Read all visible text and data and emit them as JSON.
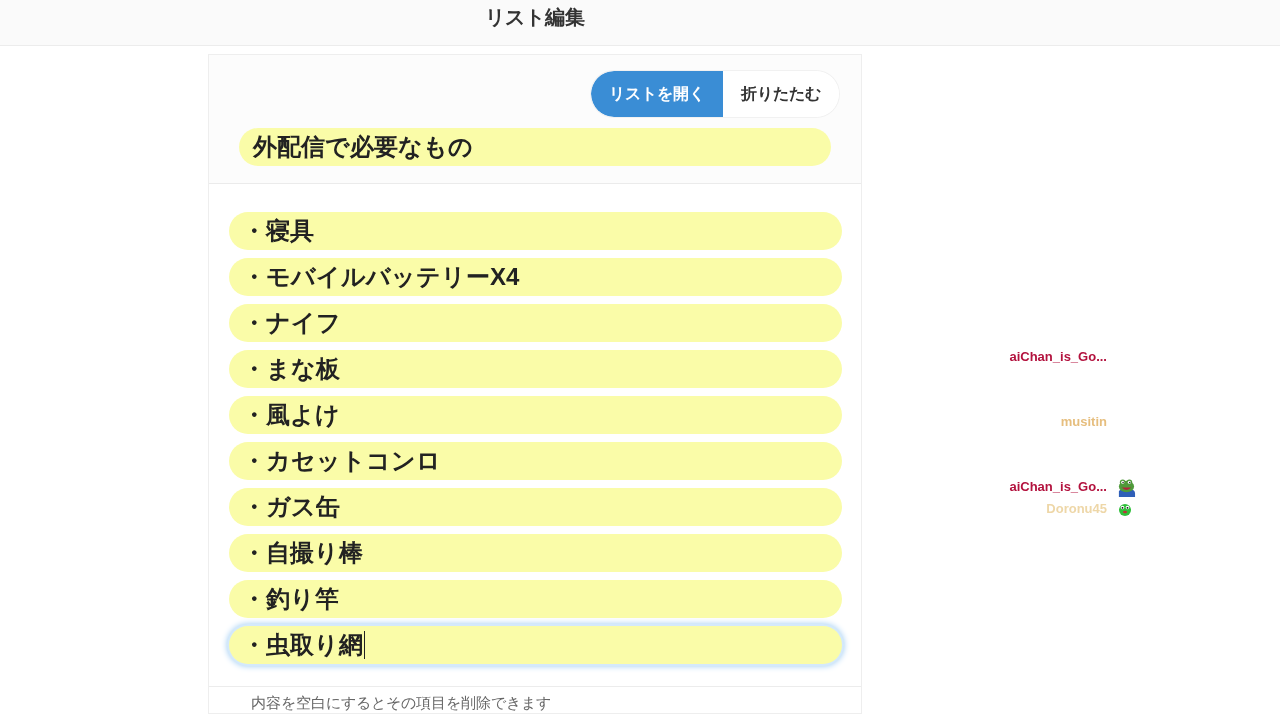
{
  "header": {
    "title": "リスト編集"
  },
  "list_editor": {
    "view_toggle": [
      {
        "label": "リストを開く",
        "selected": true
      },
      {
        "label": "折りたたむ",
        "selected": false
      }
    ],
    "list_title": "外配信で必要なもの",
    "items": [
      {
        "value": "・寝具",
        "focused": false
      },
      {
        "value": "・モバイルバッテリーX4",
        "focused": false
      },
      {
        "value": "・ナイフ",
        "focused": false
      },
      {
        "value": "・まな板",
        "focused": false
      },
      {
        "value": "・風よけ",
        "focused": false
      },
      {
        "value": "・カセットコンロ",
        "focused": false
      },
      {
        "value": "・ガス缶",
        "focused": false
      },
      {
        "value": "・自撮り棒",
        "focused": false
      },
      {
        "value": "・釣り竿",
        "focused": false
      },
      {
        "value": "・虫取り網",
        "focused": true
      }
    ],
    "hint": "内容を空白にするとその項目を削除できます"
  },
  "chat": [
    {
      "user": "aiChan_is_Go...",
      "color": "#b3123e",
      "kind": "message"
    },
    {
      "user": "musitin",
      "color": "#e6be7e",
      "kind": "message"
    },
    {
      "user": "aiChan_is_Go...",
      "color": "#b3123e",
      "kind": "frog"
    },
    {
      "user": "Doronu45",
      "color": "#eed7a8",
      "kind": "blob"
    }
  ]
}
